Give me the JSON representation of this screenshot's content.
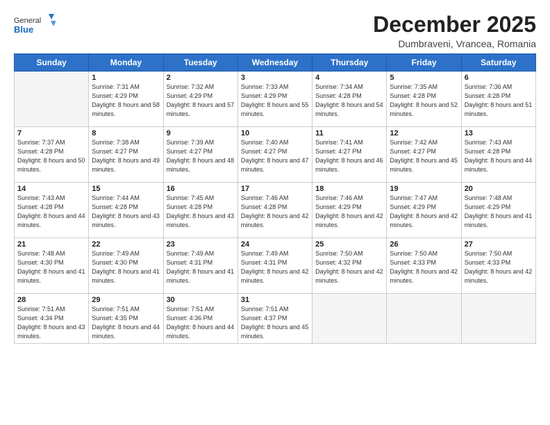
{
  "logo": {
    "general": "General",
    "blue": "Blue"
  },
  "title": "December 2025",
  "subtitle": "Dumbraveni, Vrancea, Romania",
  "days_of_week": [
    "Sunday",
    "Monday",
    "Tuesday",
    "Wednesday",
    "Thursday",
    "Friday",
    "Saturday"
  ],
  "weeks": [
    [
      {
        "day": "",
        "empty": true
      },
      {
        "day": "1",
        "sunrise": "7:31 AM",
        "sunset": "4:29 PM",
        "daylight": "8 hours and 58 minutes."
      },
      {
        "day": "2",
        "sunrise": "7:32 AM",
        "sunset": "4:29 PM",
        "daylight": "8 hours and 57 minutes."
      },
      {
        "day": "3",
        "sunrise": "7:33 AM",
        "sunset": "4:29 PM",
        "daylight": "8 hours and 55 minutes."
      },
      {
        "day": "4",
        "sunrise": "7:34 AM",
        "sunset": "4:28 PM",
        "daylight": "8 hours and 54 minutes."
      },
      {
        "day": "5",
        "sunrise": "7:35 AM",
        "sunset": "4:28 PM",
        "daylight": "8 hours and 52 minutes."
      },
      {
        "day": "6",
        "sunrise": "7:36 AM",
        "sunset": "4:28 PM",
        "daylight": "8 hours and 51 minutes."
      }
    ],
    [
      {
        "day": "7",
        "sunrise": "7:37 AM",
        "sunset": "4:28 PM",
        "daylight": "8 hours and 50 minutes."
      },
      {
        "day": "8",
        "sunrise": "7:38 AM",
        "sunset": "4:27 PM",
        "daylight": "8 hours and 49 minutes."
      },
      {
        "day": "9",
        "sunrise": "7:39 AM",
        "sunset": "4:27 PM",
        "daylight": "8 hours and 48 minutes."
      },
      {
        "day": "10",
        "sunrise": "7:40 AM",
        "sunset": "4:27 PM",
        "daylight": "8 hours and 47 minutes."
      },
      {
        "day": "11",
        "sunrise": "7:41 AM",
        "sunset": "4:27 PM",
        "daylight": "8 hours and 46 minutes."
      },
      {
        "day": "12",
        "sunrise": "7:42 AM",
        "sunset": "4:27 PM",
        "daylight": "8 hours and 45 minutes."
      },
      {
        "day": "13",
        "sunrise": "7:43 AM",
        "sunset": "4:28 PM",
        "daylight": "8 hours and 44 minutes."
      }
    ],
    [
      {
        "day": "14",
        "sunrise": "7:43 AM",
        "sunset": "4:28 PM",
        "daylight": "8 hours and 44 minutes."
      },
      {
        "day": "15",
        "sunrise": "7:44 AM",
        "sunset": "4:28 PM",
        "daylight": "8 hours and 43 minutes."
      },
      {
        "day": "16",
        "sunrise": "7:45 AM",
        "sunset": "4:28 PM",
        "daylight": "8 hours and 43 minutes."
      },
      {
        "day": "17",
        "sunrise": "7:46 AM",
        "sunset": "4:28 PM",
        "daylight": "8 hours and 42 minutes."
      },
      {
        "day": "18",
        "sunrise": "7:46 AM",
        "sunset": "4:29 PM",
        "daylight": "8 hours and 42 minutes."
      },
      {
        "day": "19",
        "sunrise": "7:47 AM",
        "sunset": "4:29 PM",
        "daylight": "8 hours and 42 minutes."
      },
      {
        "day": "20",
        "sunrise": "7:48 AM",
        "sunset": "4:29 PM",
        "daylight": "8 hours and 41 minutes."
      }
    ],
    [
      {
        "day": "21",
        "sunrise": "7:48 AM",
        "sunset": "4:30 PM",
        "daylight": "8 hours and 41 minutes."
      },
      {
        "day": "22",
        "sunrise": "7:49 AM",
        "sunset": "4:30 PM",
        "daylight": "8 hours and 41 minutes."
      },
      {
        "day": "23",
        "sunrise": "7:49 AM",
        "sunset": "4:31 PM",
        "daylight": "8 hours and 41 minutes."
      },
      {
        "day": "24",
        "sunrise": "7:49 AM",
        "sunset": "4:31 PM",
        "daylight": "8 hours and 42 minutes."
      },
      {
        "day": "25",
        "sunrise": "7:50 AM",
        "sunset": "4:32 PM",
        "daylight": "8 hours and 42 minutes."
      },
      {
        "day": "26",
        "sunrise": "7:50 AM",
        "sunset": "4:33 PM",
        "daylight": "8 hours and 42 minutes."
      },
      {
        "day": "27",
        "sunrise": "7:50 AM",
        "sunset": "4:33 PM",
        "daylight": "8 hours and 42 minutes."
      }
    ],
    [
      {
        "day": "28",
        "sunrise": "7:51 AM",
        "sunset": "4:34 PM",
        "daylight": "8 hours and 43 minutes."
      },
      {
        "day": "29",
        "sunrise": "7:51 AM",
        "sunset": "4:35 PM",
        "daylight": "8 hours and 44 minutes."
      },
      {
        "day": "30",
        "sunrise": "7:51 AM",
        "sunset": "4:36 PM",
        "daylight": "8 hours and 44 minutes."
      },
      {
        "day": "31",
        "sunrise": "7:51 AM",
        "sunset": "4:37 PM",
        "daylight": "8 hours and 45 minutes."
      },
      {
        "day": "",
        "empty": true
      },
      {
        "day": "",
        "empty": true
      },
      {
        "day": "",
        "empty": true
      }
    ]
  ]
}
